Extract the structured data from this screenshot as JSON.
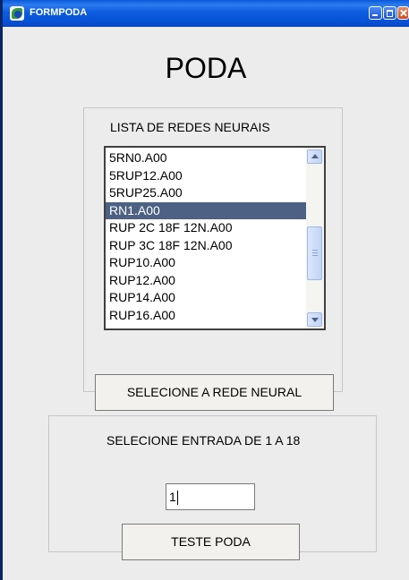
{
  "window": {
    "title": "FORMPODA"
  },
  "main": {
    "heading": "PODA"
  },
  "network_panel": {
    "label": "LISTA DE REDES NEURAIS",
    "items": [
      "5RN0.A00",
      "5RUP12.A00",
      "5RUP25.A00",
      "RN1.A00",
      "RUP 2C 18F 12N.A00",
      "RUP 3C 18F 12N.A00",
      "RUP10.A00",
      "RUP12.A00",
      "RUP14.A00",
      "RUP16.A00"
    ],
    "selected_item": "RN1.A00",
    "select_button_label": "SELECIONE A REDE NEURAL"
  },
  "entry_panel": {
    "label": "SELECIONE ENTRADA DE 1 A 18",
    "input_value": "1",
    "test_button_label": "TESTE PODA"
  },
  "colors": {
    "selection": "#4d6185",
    "titlebar": "#0752d6"
  },
  "icons": {
    "app": "app-icon",
    "minimize": "minimize-icon",
    "maximize": "maximize-icon",
    "close": "close-icon"
  }
}
